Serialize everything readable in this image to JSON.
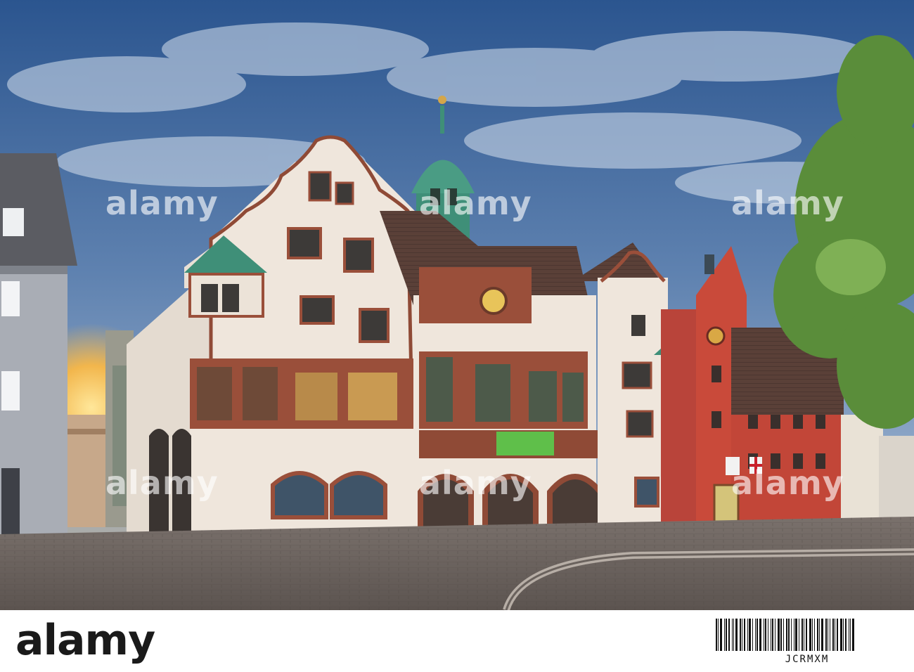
{
  "watermark": {
    "text": "alamy"
  },
  "footer": {
    "logo_text": "alamy",
    "image_id": "JCRMXM"
  },
  "colors": {
    "sky_top": "#2f5d9c",
    "sky_mid": "#6f8fb8",
    "sunset": "#f2c15a",
    "facade_cream": "#efe6dc",
    "sandstone": "#9a4f3a",
    "copper_green": "#3f8f78",
    "red_building": "#c94a3a",
    "roof_dark": "#4a3a34",
    "cobblestone": "#8c8079"
  }
}
